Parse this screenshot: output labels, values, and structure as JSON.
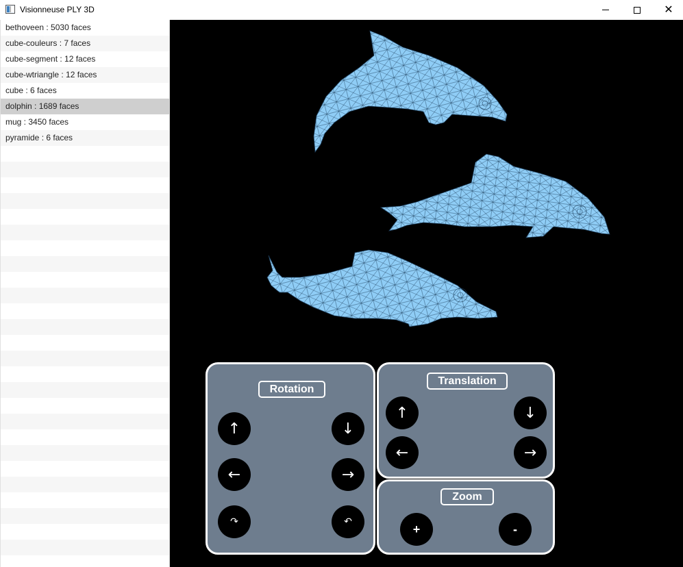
{
  "window": {
    "title": "Visionneuse PLY 3D",
    "close_symbol": "✕"
  },
  "sidebar": {
    "items": [
      {
        "label": "bethoveen : 5030 faces"
      },
      {
        "label": "cube-couleurs : 7 faces"
      },
      {
        "label": "cube-segment : 12 faces"
      },
      {
        "label": "cube-wtriangle : 12 faces"
      },
      {
        "label": "cube : 6 faces"
      },
      {
        "label": "dolphin : 1689 faces",
        "selected": true
      },
      {
        "label": "mug : 3450 faces"
      },
      {
        "label": "pyramide : 6 faces"
      }
    ],
    "selected_index": 5
  },
  "viewport": {
    "background": "#000000",
    "model_fill": "#8fcdf6",
    "model_stroke": "#1f3f5c"
  },
  "controls": {
    "rotation": {
      "title": "Rotation",
      "buttons": {
        "up": "↑",
        "down": "↓",
        "left": "←",
        "right": "→",
        "rotate_cw": "↷",
        "rotate_ccw": "↶"
      }
    },
    "translation": {
      "title": "Translation",
      "buttons": {
        "up": "↑",
        "down": "↓",
        "left": "←",
        "right": "→"
      }
    },
    "zoom": {
      "title": "Zoom",
      "buttons": {
        "plus": "+",
        "minus": "-"
      }
    },
    "panel_color": "#6e7d8e"
  }
}
